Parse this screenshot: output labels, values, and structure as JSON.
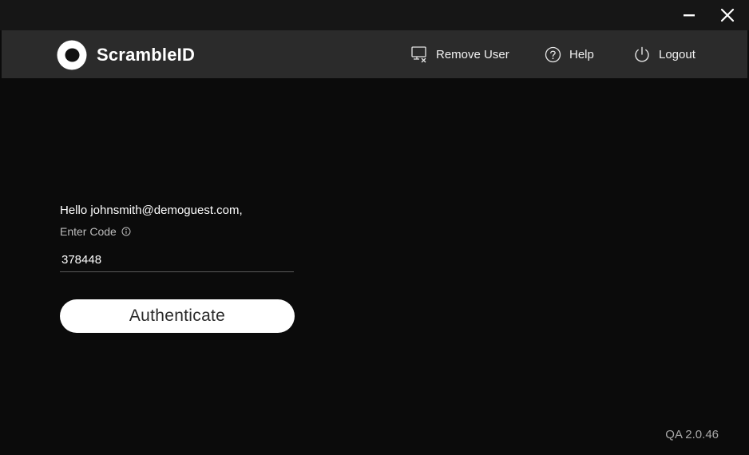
{
  "window": {
    "minimize_icon": "minimize-icon",
    "close_icon": "close-icon"
  },
  "header": {
    "brand": "ScrambleID",
    "nav": {
      "remove_user": {
        "label": "Remove User",
        "icon": "remove-user-icon"
      },
      "help": {
        "label": "Help",
        "icon": "help-icon"
      },
      "logout": {
        "label": "Logout",
        "icon": "power-icon"
      }
    }
  },
  "auth": {
    "greeting": "Hello johnsmith@demoguest.com,",
    "code_label": "Enter Code",
    "code_info_icon": "info-icon",
    "code_value": "378448",
    "submit_label": "Authenticate"
  },
  "footer": {
    "version": "QA 2.0.46"
  },
  "colors": {
    "background": "#0b0b0b",
    "titlebar": "#161616",
    "header": "#2b2b2b",
    "button_bg": "#ffffff",
    "button_text": "#2a2a2a"
  }
}
